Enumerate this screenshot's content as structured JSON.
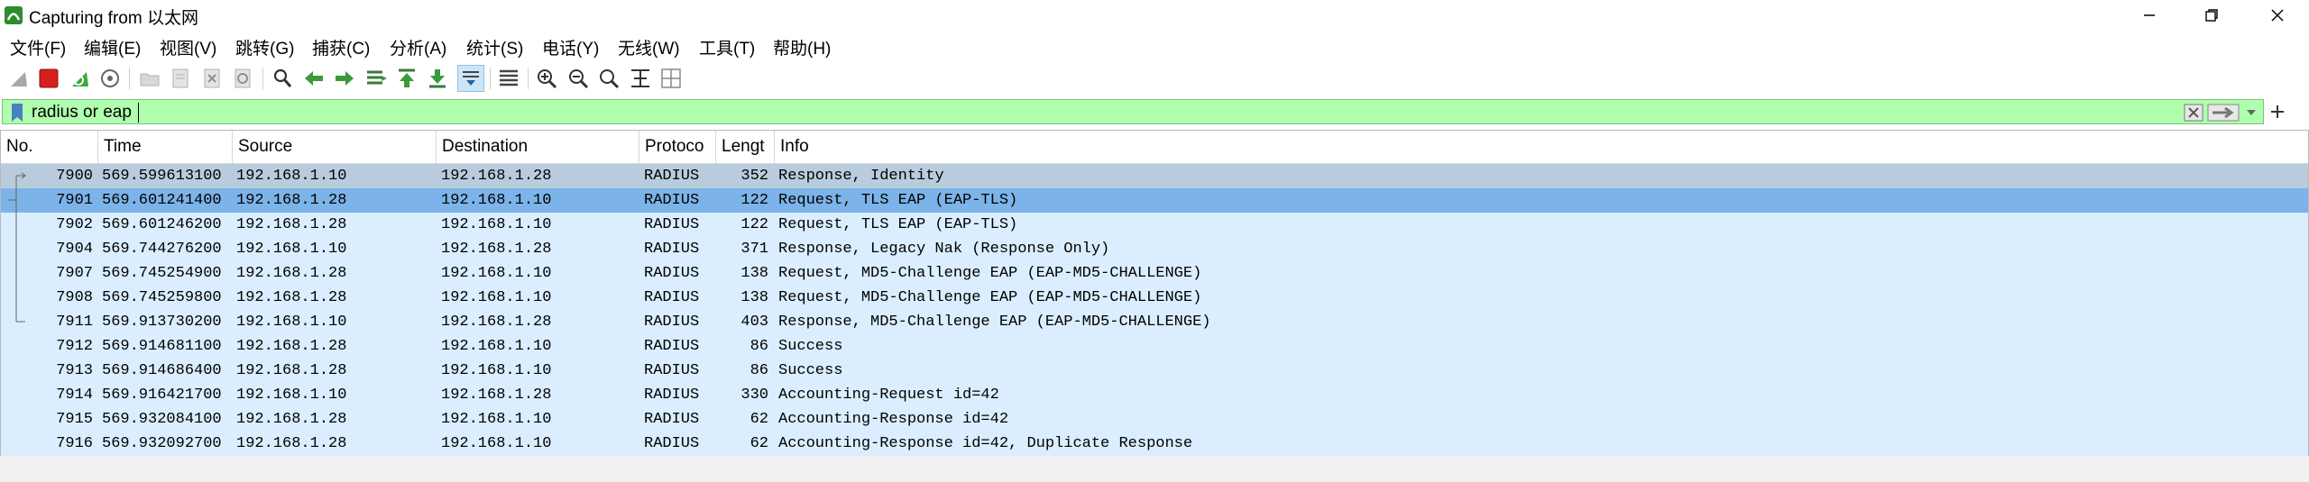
{
  "window": {
    "title": "Capturing from 以太网",
    "controls": [
      "minimize",
      "maximize",
      "close"
    ]
  },
  "menu": [
    {
      "label": "文件(F)"
    },
    {
      "label": "编辑(E)"
    },
    {
      "label": "视图(V)"
    },
    {
      "label": "跳转(G)"
    },
    {
      "label": "捕获(C)"
    },
    {
      "label": "分析(A)"
    },
    {
      "label": "统计(S)"
    },
    {
      "label": "电话(Y)"
    },
    {
      "label": "无线(W)"
    },
    {
      "label": "工具(T)"
    },
    {
      "label": "帮助(H)"
    }
  ],
  "toolbar": {
    "icons": [
      "shark-fin-icon",
      "stop-capture-icon",
      "restart-capture-icon",
      "capture-options-icon",
      "open-file-icon",
      "save-file-icon",
      "close-file-icon",
      "reload-file-icon",
      "find-packet-icon",
      "go-back-icon",
      "go-forward-icon",
      "go-to-packet-icon",
      "first-packet-icon",
      "last-packet-icon",
      "autoscroll-icon",
      "colorize-icon",
      "zoom-in-icon",
      "zoom-out-icon",
      "normal-size-icon",
      "resize-columns-icon",
      "layout-icon"
    ]
  },
  "filter": {
    "value": "radius or eap",
    "background": "#afffaf"
  },
  "packet_list": {
    "columns": [
      "No.",
      "Time",
      "Source",
      "Destination",
      "Protoco",
      "Lengt",
      "Info"
    ],
    "rows": [
      {
        "no": "7900",
        "time": "569.599613100",
        "source": "192.168.1.10",
        "destination": "192.168.1.28",
        "protocol": "RADIUS",
        "length": "352",
        "info": "Response, Identity",
        "state": "related"
      },
      {
        "no": "7901",
        "time": "569.601241400",
        "source": "192.168.1.28",
        "destination": "192.168.1.10",
        "protocol": "RADIUS",
        "length": "122",
        "info": "Request, TLS EAP (EAP-TLS)",
        "state": "selected"
      },
      {
        "no": "7902",
        "time": "569.601246200",
        "source": "192.168.1.28",
        "destination": "192.168.1.10",
        "protocol": "RADIUS",
        "length": "122",
        "info": "Request, TLS EAP (EAP-TLS)",
        "state": "normal"
      },
      {
        "no": "7904",
        "time": "569.744276200",
        "source": "192.168.1.10",
        "destination": "192.168.1.28",
        "protocol": "RADIUS",
        "length": "371",
        "info": "Response, Legacy Nak (Response Only)",
        "state": "normal"
      },
      {
        "no": "7907",
        "time": "569.745254900",
        "source": "192.168.1.28",
        "destination": "192.168.1.10",
        "protocol": "RADIUS",
        "length": "138",
        "info": "Request, MD5-Challenge EAP (EAP-MD5-CHALLENGE)",
        "state": "normal"
      },
      {
        "no": "7908",
        "time": "569.745259800",
        "source": "192.168.1.28",
        "destination": "192.168.1.10",
        "protocol": "RADIUS",
        "length": "138",
        "info": "Request, MD5-Challenge EAP (EAP-MD5-CHALLENGE)",
        "state": "normal"
      },
      {
        "no": "7911",
        "time": "569.913730200",
        "source": "192.168.1.10",
        "destination": "192.168.1.28",
        "protocol": "RADIUS",
        "length": "403",
        "info": "Response, MD5-Challenge EAP (EAP-MD5-CHALLENGE)",
        "state": "normal"
      },
      {
        "no": "7912",
        "time": "569.914681100",
        "source": "192.168.1.28",
        "destination": "192.168.1.10",
        "protocol": "RADIUS",
        "length": "86",
        "info": "Success",
        "state": "normal"
      },
      {
        "no": "7913",
        "time": "569.914686400",
        "source": "192.168.1.28",
        "destination": "192.168.1.10",
        "protocol": "RADIUS",
        "length": "86",
        "info": "Success",
        "state": "normal"
      },
      {
        "no": "7914",
        "time": "569.916421700",
        "source": "192.168.1.10",
        "destination": "192.168.1.28",
        "protocol": "RADIUS",
        "length": "330",
        "info": "Accounting-Request id=42",
        "state": "normal"
      },
      {
        "no": "7915",
        "time": "569.932084100",
        "source": "192.168.1.28",
        "destination": "192.168.1.10",
        "protocol": "RADIUS",
        "length": "62",
        "info": "Accounting-Response id=42",
        "state": "normal"
      },
      {
        "no": "7916",
        "time": "569.932092700",
        "source": "192.168.1.28",
        "destination": "192.168.1.10",
        "protocol": "RADIUS",
        "length": "62",
        "info": "Accounting-Response id=42, Duplicate Response",
        "state": "normal"
      }
    ]
  }
}
